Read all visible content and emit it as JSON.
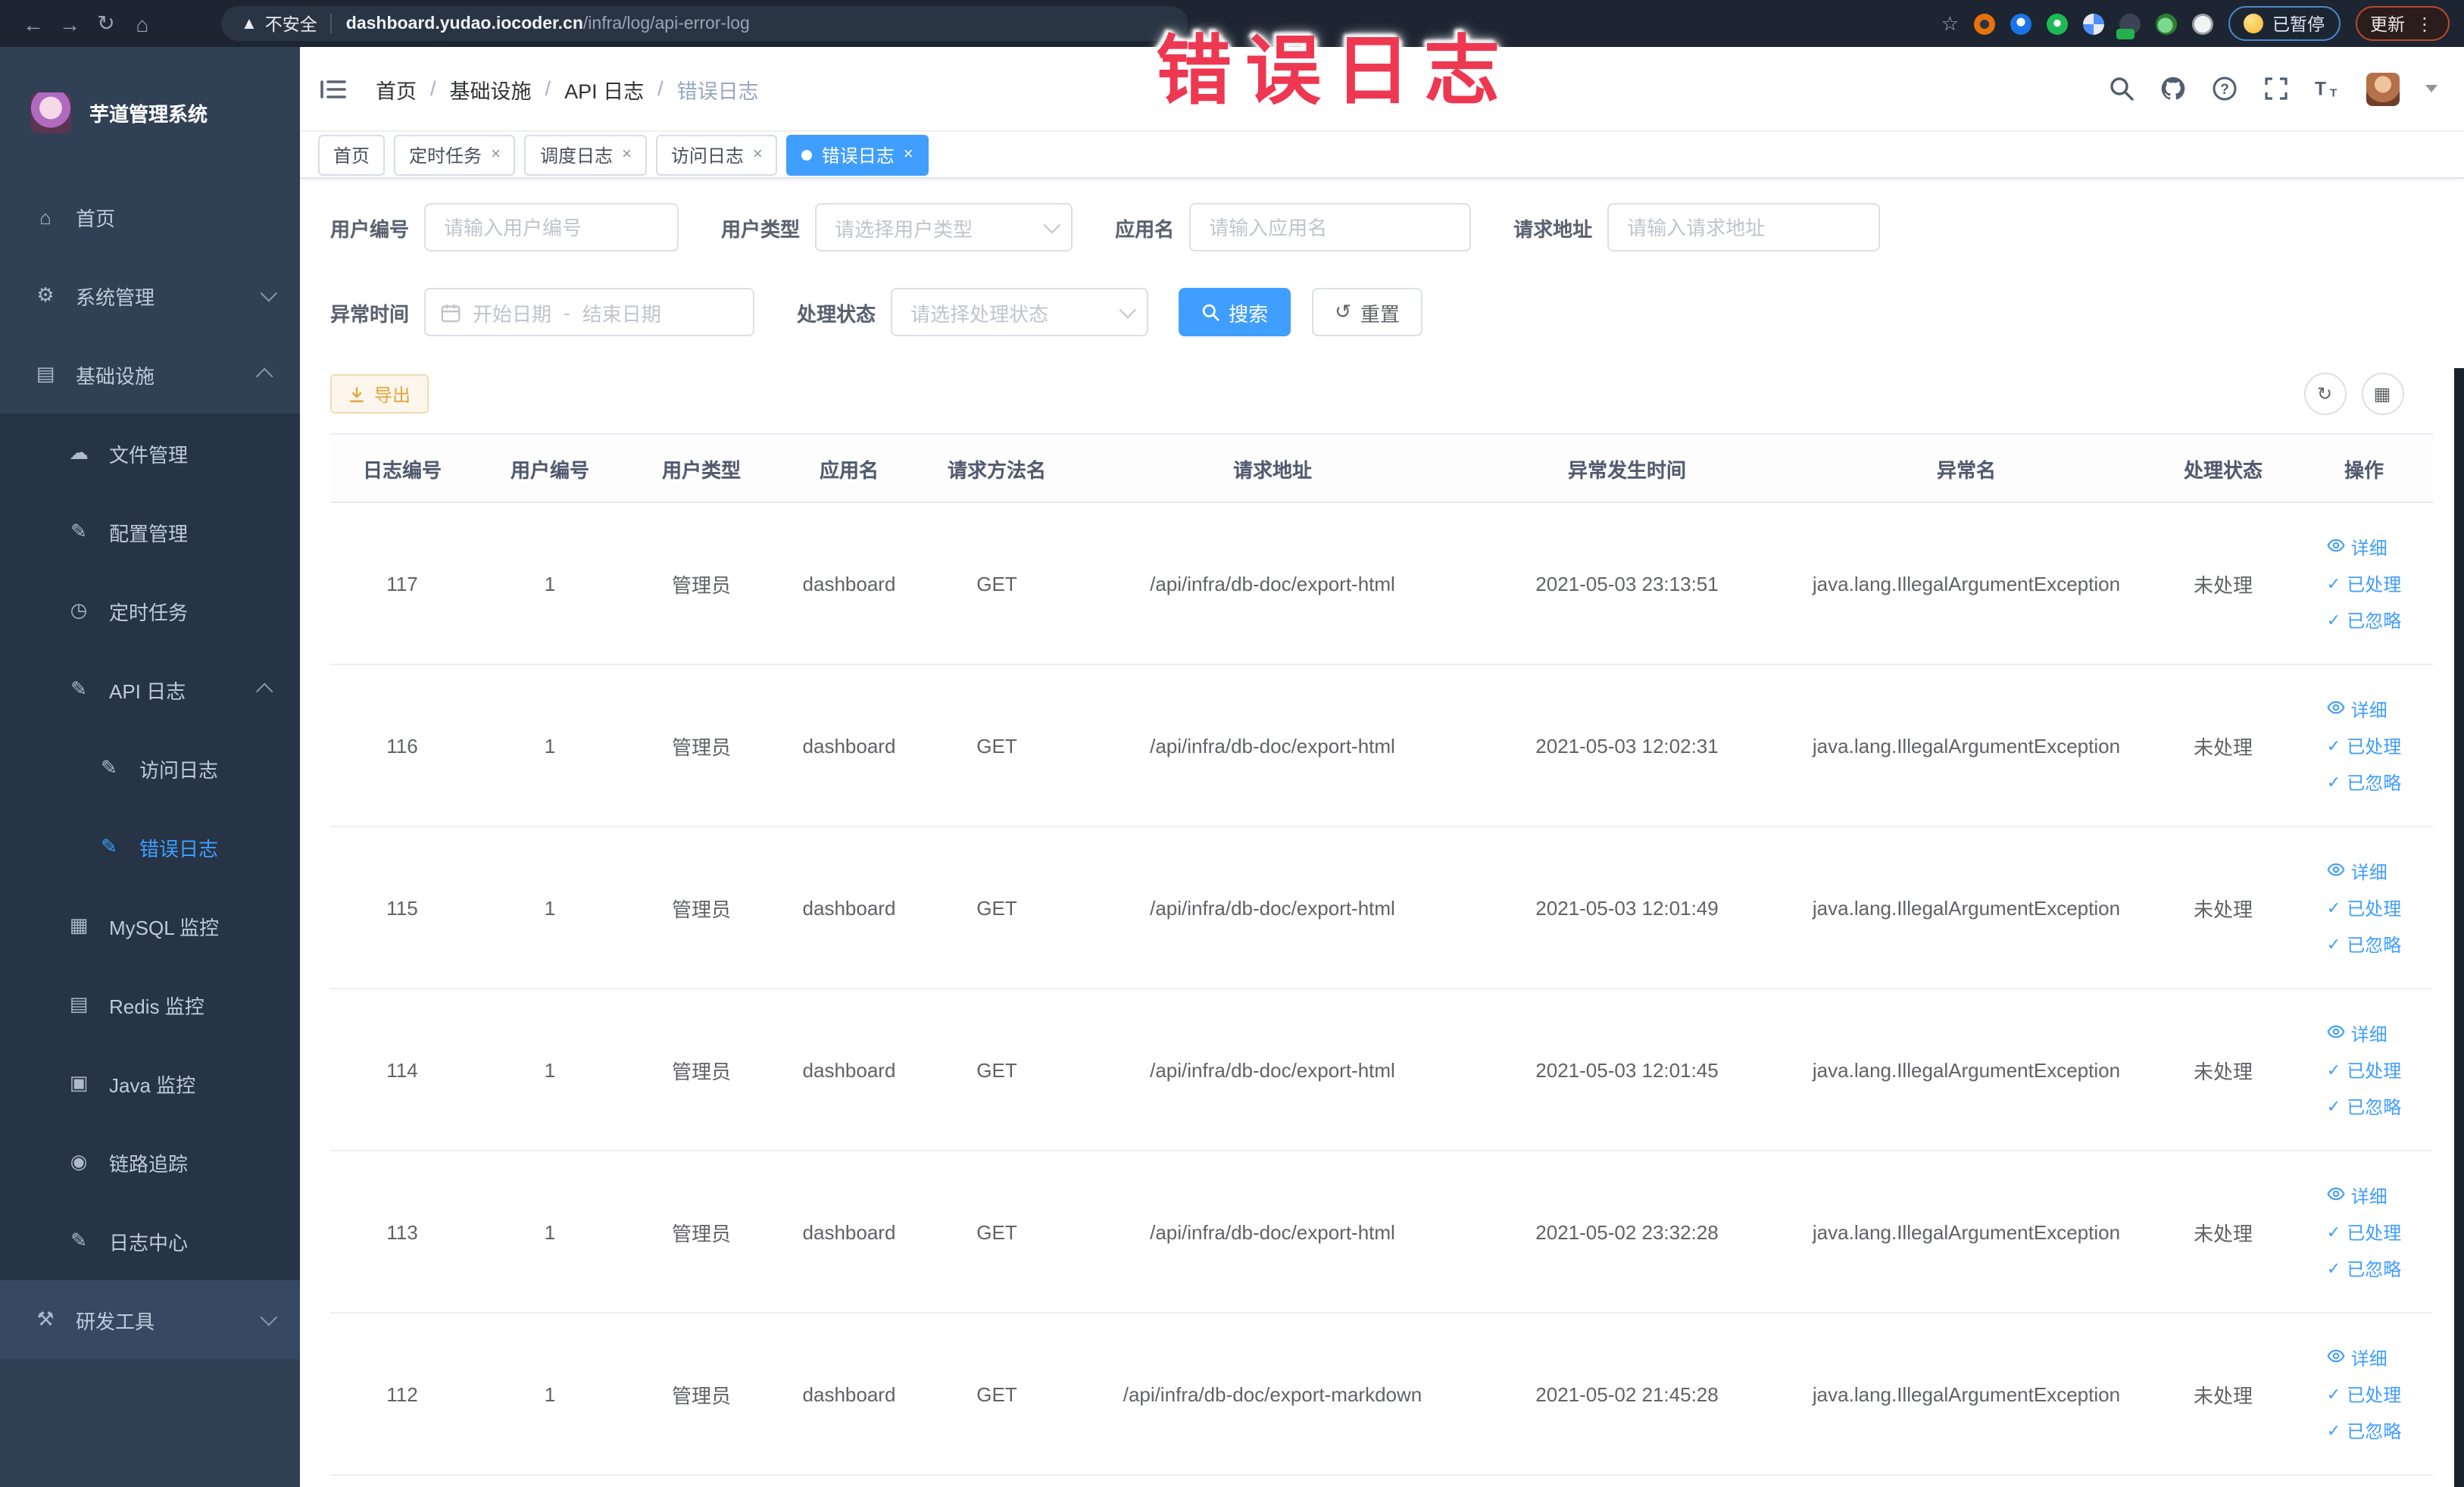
{
  "browser": {
    "security_label": "不安全",
    "url_domain": "dashboard.yudao.iocoder.cn",
    "url_path": "/infra/log/api-error-log",
    "paused_label": "已暂停",
    "update_label": "更新"
  },
  "overlay": {
    "text": "错误日志",
    "color": "#ee3750"
  },
  "sidebar": {
    "title": "芋道管理系统",
    "items": [
      {
        "key": "home",
        "label": "首页",
        "icon": "home",
        "level": "root"
      },
      {
        "key": "system-mgmt",
        "label": "系统管理",
        "icon": "gear",
        "level": "root",
        "chevron": "down"
      },
      {
        "key": "infrastructure",
        "label": "基础设施",
        "icon": "monitor",
        "level": "root",
        "chevron": "up"
      },
      {
        "key": "file-mgmt",
        "label": "文件管理",
        "icon": "cloud",
        "level": "sub"
      },
      {
        "key": "config-mgmt",
        "label": "配置管理",
        "icon": "edit",
        "level": "sub"
      },
      {
        "key": "scheduled-jobs",
        "label": "定时任务",
        "icon": "clock",
        "level": "sub"
      },
      {
        "key": "api-log",
        "label": "API 日志",
        "icon": "doc",
        "level": "sub",
        "chevron": "up"
      },
      {
        "key": "access-log",
        "label": "访问日志",
        "icon": "doc",
        "level": "subsub"
      },
      {
        "key": "error-log",
        "label": "错误日志",
        "icon": "doc",
        "level": "subsub",
        "active": true
      },
      {
        "key": "mysql-monitor",
        "label": "MySQL 监控",
        "icon": "chart",
        "level": "sub"
      },
      {
        "key": "redis-monitor",
        "label": "Redis 监控",
        "icon": "layers",
        "level": "sub"
      },
      {
        "key": "java-monitor",
        "label": "Java 监控",
        "icon": "coffee",
        "level": "sub"
      },
      {
        "key": "trace",
        "label": "链路追踪",
        "icon": "eye",
        "level": "sub"
      },
      {
        "key": "log-center",
        "label": "日志中心",
        "icon": "doc",
        "level": "sub"
      },
      {
        "key": "dev-tools",
        "label": "研发工具",
        "icon": "tools",
        "level": "root",
        "chevron": "down",
        "highlight": true
      }
    ]
  },
  "header": {
    "breadcrumb": [
      "首页",
      "基础设施",
      "API 日志",
      "错误日志"
    ]
  },
  "tabs": [
    {
      "label": "首页",
      "closable": false,
      "active": false
    },
    {
      "label": "定时任务",
      "closable": true,
      "active": false
    },
    {
      "label": "调度日志",
      "closable": true,
      "active": false
    },
    {
      "label": "访问日志",
      "closable": true,
      "active": false
    },
    {
      "label": "错误日志",
      "closable": true,
      "active": true
    }
  ],
  "filters": {
    "user_id": {
      "label": "用户编号",
      "placeholder": "请输入用户编号"
    },
    "user_type": {
      "label": "用户类型",
      "placeholder": "请选择用户类型"
    },
    "app_name": {
      "label": "应用名",
      "placeholder": "请输入应用名"
    },
    "request_url": {
      "label": "请求地址",
      "placeholder": "请输入请求地址"
    },
    "exception_time": {
      "label": "异常时间",
      "start_placeholder": "开始日期",
      "separator": "-",
      "end_placeholder": "结束日期"
    },
    "process_status": {
      "label": "处理状态",
      "placeholder": "请选择处理状态"
    },
    "search_label": "搜索",
    "reset_label": "重置"
  },
  "toolbar": {
    "export_label": "导出"
  },
  "table": {
    "columns": [
      "日志编号",
      "用户编号",
      "用户类型",
      "应用名",
      "请求方法名",
      "请求地址",
      "异常发生时间",
      "异常名",
      "处理状态",
      "操作"
    ],
    "row_actions": [
      "详细",
      "已处理",
      "已忽略"
    ],
    "rows": [
      {
        "id": "117",
        "user_id": "1",
        "user_type": "管理员",
        "app_name": "dashboard",
        "method": "GET",
        "url": "/api/infra/db-doc/export-html",
        "time": "2021-05-03 23:13:51",
        "exception": "java.lang.IllegalArgumentException",
        "status": "未处理"
      },
      {
        "id": "116",
        "user_id": "1",
        "user_type": "管理员",
        "app_name": "dashboard",
        "method": "GET",
        "url": "/api/infra/db-doc/export-html",
        "time": "2021-05-03 12:02:31",
        "exception": "java.lang.IllegalArgumentException",
        "status": "未处理"
      },
      {
        "id": "115",
        "user_id": "1",
        "user_type": "管理员",
        "app_name": "dashboard",
        "method": "GET",
        "url": "/api/infra/db-doc/export-html",
        "time": "2021-05-03 12:01:49",
        "exception": "java.lang.IllegalArgumentException",
        "status": "未处理"
      },
      {
        "id": "114",
        "user_id": "1",
        "user_type": "管理员",
        "app_name": "dashboard",
        "method": "GET",
        "url": "/api/infra/db-doc/export-html",
        "time": "2021-05-03 12:01:45",
        "exception": "java.lang.IllegalArgumentException",
        "status": "未处理"
      },
      {
        "id": "113",
        "user_id": "1",
        "user_type": "管理员",
        "app_name": "dashboard",
        "method": "GET",
        "url": "/api/infra/db-doc/export-html",
        "time": "2021-05-02 23:32:28",
        "exception": "java.lang.IllegalArgumentException",
        "status": "未处理"
      },
      {
        "id": "112",
        "user_id": "1",
        "user_type": "管理员",
        "app_name": "dashboard",
        "method": "GET",
        "url": "/api/infra/db-doc/export-markdown",
        "time": "2021-05-02 21:45:28",
        "exception": "java.lang.IllegalArgumentException",
        "status": "未处理"
      }
    ]
  },
  "colors": {
    "accent": "#409eff",
    "warning": "#e6a23c",
    "sidebar_bg": "#304156",
    "chrome_bg": "#1c2531"
  }
}
